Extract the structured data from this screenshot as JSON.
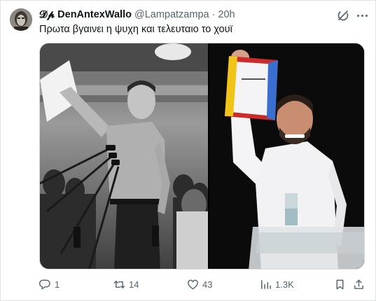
{
  "tweet": {
    "author": {
      "display_name": "𝓓𝓹 DenAntexWallo",
      "handle": "@Lampatzampa",
      "separator": "·",
      "time": "20h"
    },
    "text": "Πρωτα βγαινει η ψυχη και τελευταιο το χουϊ",
    "icons": {
      "grok": "grok-icon",
      "more": "more-icon"
    },
    "media": {
      "count": 2,
      "images": [
        {
          "name": "left-photo",
          "style": "black-and-white"
        },
        {
          "name": "right-photo",
          "style": "color"
        }
      ]
    },
    "actions": {
      "replies": "1",
      "reposts": "14",
      "likes": "43",
      "views": "1.3K"
    }
  },
  "colors": {
    "text": "#0f1419",
    "secondary": "#536471",
    "border": "#cfd9de",
    "frame": "#dfe3e7"
  }
}
